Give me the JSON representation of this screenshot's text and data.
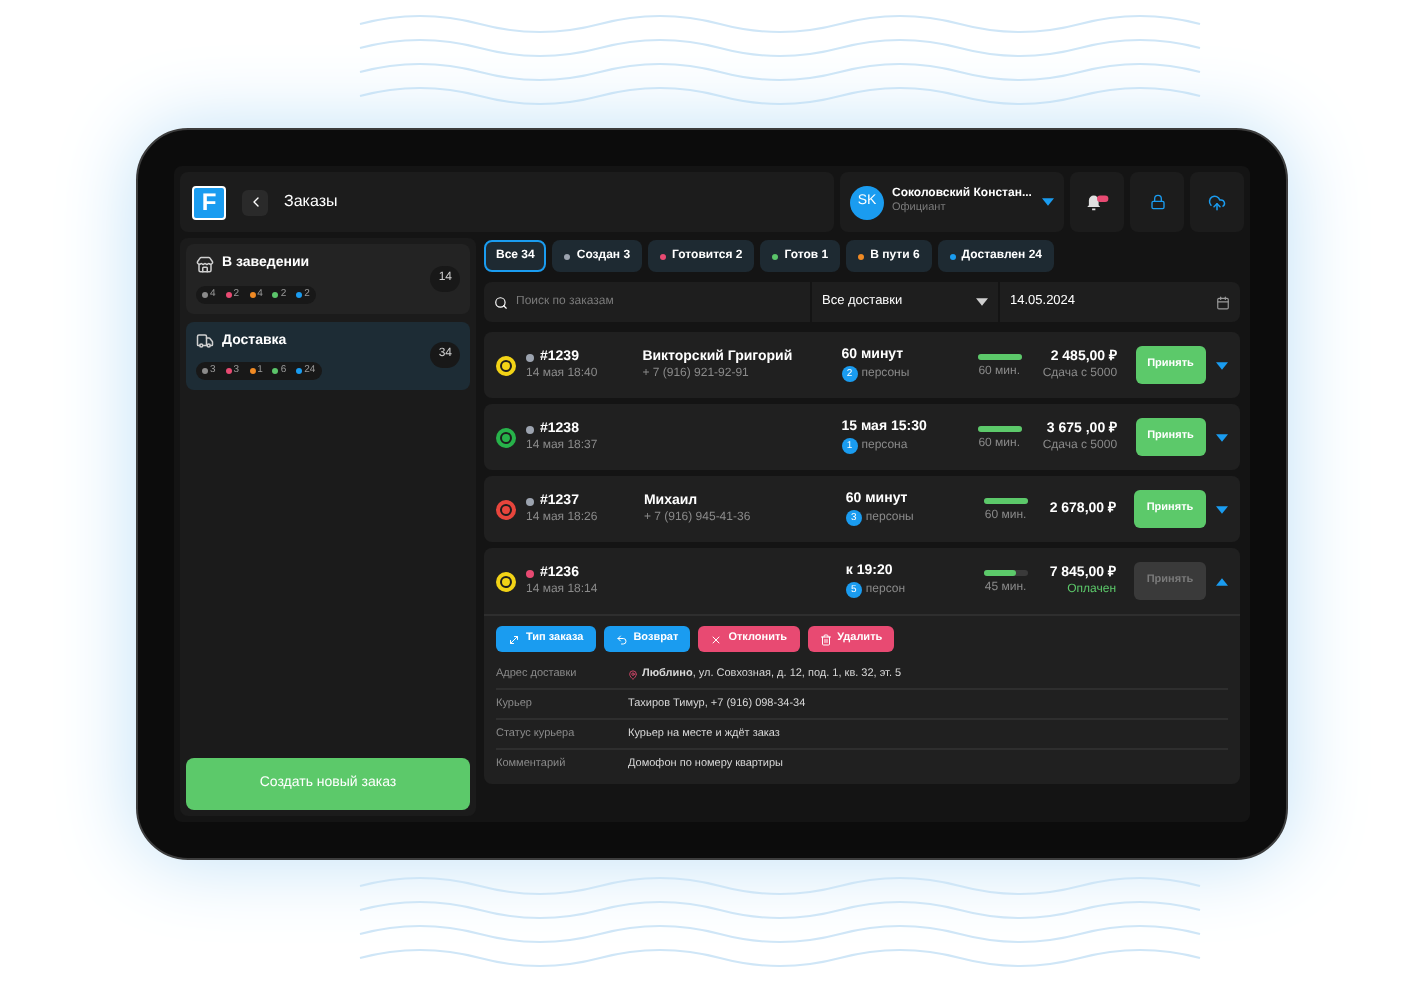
{
  "app": {
    "logo": "F",
    "title": "Заказы"
  },
  "user": {
    "initials": "SK",
    "name": "Соколовский Констан...",
    "role": "Официант"
  },
  "venues": [
    {
      "kind": "dine_in",
      "name": "В заведении",
      "count": "14",
      "selected": false,
      "stats": [
        {
          "color": "#8a8a8a",
          "value": "4"
        },
        {
          "color": "#e84a72",
          "value": "2"
        },
        {
          "color": "#f08a24",
          "value": "4"
        },
        {
          "color": "#5bc46a",
          "value": "2"
        },
        {
          "color": "#1a9cf0",
          "value": "2"
        }
      ]
    },
    {
      "kind": "delivery",
      "name": "Доставка",
      "count": "34",
      "selected": true,
      "stats": [
        {
          "color": "#8a8a8a",
          "value": "3"
        },
        {
          "color": "#e84a72",
          "value": "3"
        },
        {
          "color": "#f08a24",
          "value": "1"
        },
        {
          "color": "#5bc46a",
          "value": "6"
        },
        {
          "color": "#1a9cf0",
          "value": "24"
        }
      ]
    }
  ],
  "create_button": "Создать новый заказ",
  "tabs": [
    {
      "label": "Все 34",
      "selected": true
    },
    {
      "label": "Создан 3",
      "color": "#9ca3af",
      "selected": false
    },
    {
      "label": "Готовится 2",
      "color": "#e84a72",
      "selected": false
    },
    {
      "label": "Готов 1",
      "color": "#5bc46a",
      "selected": false
    },
    {
      "label": "В пути 6",
      "color": "#f08a24",
      "selected": false
    },
    {
      "label": "Доставлен 24",
      "color": "#1a9cf0",
      "selected": false
    }
  ],
  "search": {
    "placeholder": "Поиск по заказам"
  },
  "delivery_filter": {
    "value": "Все доставки"
  },
  "date": {
    "value": "14.05.2024"
  },
  "orders": [
    {
      "source": {
        "color": "#f2d316"
      },
      "color": "#9ca3af",
      "number": "#1239",
      "date": "14 мая 18:40",
      "customer": "Викторский Григорий",
      "phone": "+ 7 (916) 921-92-91",
      "time": "60 минут",
      "persons": "2",
      "persons_label": "персоны",
      "level": 1,
      "duration": "60 мин.",
      "total": "2 485,00 ₽",
      "note": {
        "kind": "change",
        "text": "Сдача с 5000"
      },
      "accept": {
        "label": "Принять",
        "disabled": false
      },
      "expanded": false
    },
    {
      "source": {
        "color": "#27b24a"
      },
      "color": "#9ca3af",
      "number": "#1238",
      "date": "14 мая 18:37",
      "time": "15 мая 15:30",
      "persons": "1",
      "persons_label": "персона",
      "level": 1,
      "duration": "60 мин.",
      "total": "3 675 ,00 ₽",
      "note": {
        "kind": "change",
        "text": "Сдача с 5000"
      },
      "accept": {
        "label": "Принять",
        "disabled": false
      },
      "expanded": false
    },
    {
      "source": {
        "color": "#e8453c"
      },
      "color": "#9ca3af",
      "number": "#1237",
      "date": "14 мая 18:26",
      "customer": "Михаил",
      "phone": "+ 7 (916) 945-41-36",
      "time": "60 минут",
      "persons": "3",
      "persons_label": "персоны",
      "level": 1,
      "duration": "60 мин.",
      "total": "2 678,00 ₽",
      "accept": {
        "label": "Принять",
        "disabled": false
      },
      "expanded": false
    },
    {
      "source": {
        "color": "#f2d316"
      },
      "color": "#e84a72",
      "number": "#1236",
      "date": "14 мая 18:14",
      "time": "к 19:20",
      "persons": "5",
      "persons_label": "персон",
      "level": 0.75,
      "duration": "45 мин.",
      "total": "7 845,00 ₽",
      "note": {
        "kind": "paid",
        "text": "Оплачен"
      },
      "accept": {
        "label": "Принять",
        "disabled": true
      },
      "expanded": true,
      "actions": [
        {
          "kind": "type",
          "label": "Тип заказа"
        },
        {
          "kind": "refund",
          "label": "Возврат"
        },
        {
          "kind": "reject",
          "label": "Отклонить"
        },
        {
          "kind": "delete",
          "label": "Удалить"
        }
      ],
      "details": [
        {
          "kind": "address",
          "label": "Адрес доставки",
          "value": "**Люблино**, ул. Совхозная, д. 12, под. 1, кв. 32, эт. 5"
        },
        {
          "kind": "text",
          "label": "Курьер",
          "value": "Тахиров Тимур, +7 (916) 098-34-34"
        },
        {
          "kind": "text",
          "label": "Статус курьера",
          "value": "Курьер на месте и ждёт заказ"
        },
        {
          "kind": "text",
          "label": "Комментарий",
          "value": "Домофон по номеру квартиры"
        }
      ]
    }
  ]
}
